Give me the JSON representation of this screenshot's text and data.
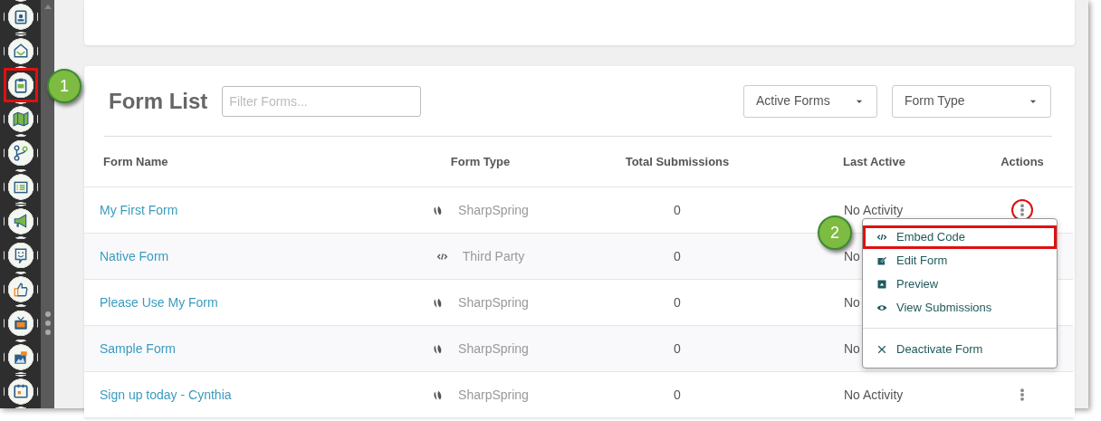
{
  "sidebar": {
    "items": [
      {
        "highlighted": false
      },
      {
        "highlighted": false
      },
      {
        "highlighted": true
      },
      {
        "highlighted": false
      },
      {
        "highlighted": false
      },
      {
        "highlighted": false
      },
      {
        "highlighted": false
      },
      {
        "highlighted": false
      },
      {
        "highlighted": false
      },
      {
        "highlighted": false
      },
      {
        "highlighted": false
      },
      {
        "highlighted": false
      }
    ]
  },
  "form_list": {
    "title": "Form List",
    "filter": {
      "placeholder": "Filter Forms..."
    },
    "dropdowns": [
      "Active Forms",
      "Form Type"
    ],
    "columns": [
      "Form Name",
      "Form Type",
      "Total Submissions",
      "Last Active",
      "Actions"
    ],
    "rows": [
      {
        "kind": "native",
        "name": "My First Form",
        "type": "SharpSpring",
        "submissions": "0",
        "last_active": "No Activity",
        "actions": {
          "circled": true
        }
      },
      {
        "kind": "embed",
        "name": "Native Form",
        "type": "Third Party",
        "submissions": "0",
        "last_active": "No"
      },
      {
        "kind": "native",
        "name": "Please Use My Form",
        "type": "SharpSpring",
        "submissions": "0",
        "last_active": "No"
      },
      {
        "kind": "native",
        "name": "Sample Form",
        "type": "SharpSpring",
        "submissions": "0",
        "last_active": "No"
      },
      {
        "kind": "native",
        "name": "Sign up today - Cynthia",
        "type": "SharpSpring",
        "submissions": "0",
        "last_active": "No Activity",
        "actions": {
          "circled": false
        }
      }
    ]
  },
  "actions_menu": {
    "items": [
      {
        "kind": "item",
        "label": "Embed Code",
        "highlighted": true
      },
      {
        "kind": "item",
        "label": "Edit Form",
        "highlighted": false
      },
      {
        "kind": "item",
        "label": "Preview",
        "highlighted": false
      },
      {
        "kind": "item",
        "label": "View Submissions",
        "highlighted": false
      },
      {
        "kind": "divider"
      },
      {
        "kind": "item",
        "label": "Deactivate Form",
        "highlighted": false
      }
    ]
  },
  "callouts": [
    "1",
    "2"
  ]
}
